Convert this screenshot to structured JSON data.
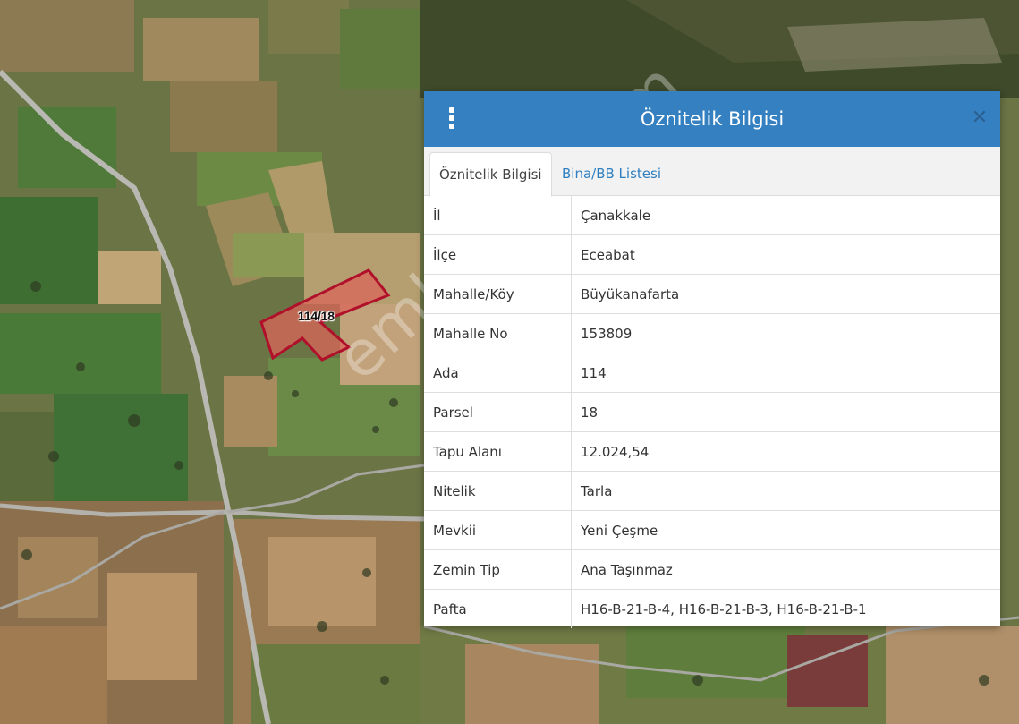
{
  "map": {
    "parcel_label": "114/18",
    "watermark": "emlakjet.com"
  },
  "panel": {
    "title": "Öznitelik Bilgisi",
    "menu_icon": "vertical-dots-icon",
    "close_icon": "close-icon",
    "tabs": [
      {
        "label": "Öznitelik Bilgisi",
        "active": true
      },
      {
        "label": "Bina/BB Listesi",
        "active": false
      }
    ],
    "rows": [
      {
        "key": "İl",
        "value": "Çanakkale"
      },
      {
        "key": "İlçe",
        "value": "Eceabat"
      },
      {
        "key": "Mahalle/Köy",
        "value": "Büyükanafarta"
      },
      {
        "key": "Mahalle No",
        "value": "153809"
      },
      {
        "key": "Ada",
        "value": "114"
      },
      {
        "key": "Parsel",
        "value": "18"
      },
      {
        "key": "Tapu Alanı",
        "value": "12.024,54"
      },
      {
        "key": "Nitelik",
        "value": "Tarla"
      },
      {
        "key": "Mevkii",
        "value": "Yeni Çeşme"
      },
      {
        "key": "Zemin Tip",
        "value": "Ana Taşınmaz"
      },
      {
        "key": "Pafta",
        "value": "H16-B-21-B-4, H16-B-21-B-3, H16-B-21-B-1"
      }
    ]
  },
  "colors": {
    "header": "#3580c1",
    "link": "#2f7fc0",
    "parcel_outline": "#b0102a",
    "parcel_fill": "#d9665a"
  }
}
